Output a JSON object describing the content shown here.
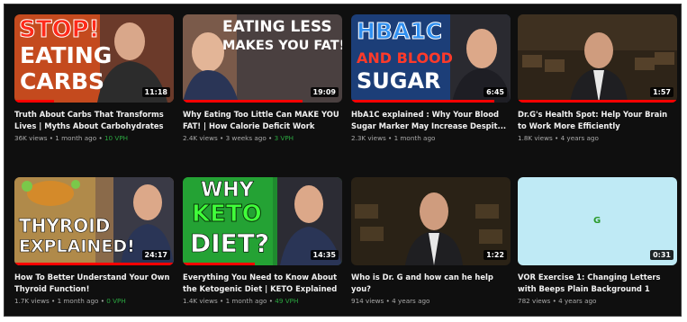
{
  "videos": [
    {
      "title": "Truth About Carbs That Transforms Lives | Myths About Carbohydrates",
      "views": "36K views",
      "age": "1 month ago",
      "vph": "10 VPH",
      "duration": "11:18",
      "thumb_text": [
        "STOP!",
        "EATING",
        "CARBS"
      ]
    },
    {
      "title": "Why Eating Too Little Can MAKE YOU FAT! | How Calorie Deficit Work",
      "views": "2.4K views",
      "age": "3 weeks ago",
      "vph": "3 VPH",
      "duration": "19:09",
      "thumb_text": [
        "EATING LESS",
        "MAKES YOU FAT!"
      ]
    },
    {
      "title": "HbA1C explained : Why Your Blood Sugar Marker May Increase Despit...",
      "views": "2.3K views",
      "age": "1 month ago",
      "vph": "",
      "duration": "6:45",
      "thumb_text": [
        "HBA1C",
        "AND BLOOD",
        "SUGAR"
      ]
    },
    {
      "title": "Dr.G's Health Spot: Help Your Brain to Work More Efficiently",
      "views": "1.8K views",
      "age": "4 years ago",
      "vph": "",
      "duration": "1:57",
      "thumb_text": []
    },
    {
      "title": "How To Better Understand Your Own Thyroid Function!",
      "views": "1.7K views",
      "age": "1 month ago",
      "vph": "0 VPH",
      "duration": "24:17",
      "thumb_text": [
        "THYROID",
        "EXPLAINED!"
      ]
    },
    {
      "title": "Everything You Need to Know About the Ketogenic Diet | KETO Explained",
      "views": "1.4K views",
      "age": "1 month ago",
      "vph": "49 VPH",
      "duration": "14:35",
      "thumb_text": [
        "WHY",
        "KETO",
        "DIET?"
      ]
    },
    {
      "title": "Who is Dr. G and how can he help you?",
      "views": "914 views",
      "age": "4 years ago",
      "vph": "",
      "duration": "1:22",
      "thumb_text": []
    },
    {
      "title": "VOR Exercise 1: Changing Letters with Beeps Plain Background 1",
      "views": "782 views",
      "age": "4 years ago",
      "vph": "",
      "duration": "0:31",
      "thumb_text": [
        "G"
      ]
    }
  ],
  "separator": "•",
  "progress": [
    0.25,
    0.75,
    0.9,
    1.0,
    1.0,
    0.45,
    0.0,
    0.0
  ],
  "colors": {
    "background": "#0f0f0f",
    "progress": "#ff0000",
    "vph": "#2ba640",
    "red_text": "#e8251d",
    "green_text": "#29d42b",
    "blue_text": "#1a78e0"
  }
}
